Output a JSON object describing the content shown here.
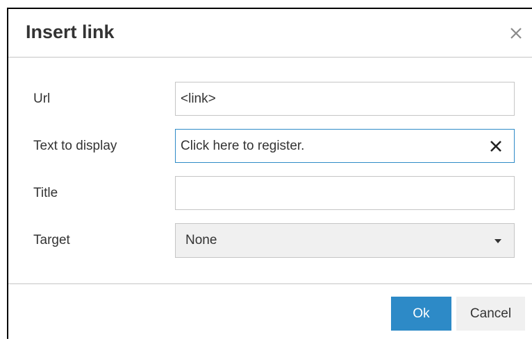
{
  "dialog": {
    "title": "Insert link",
    "close_icon": "close-icon"
  },
  "form": {
    "url": {
      "label": "Url",
      "value": "<link>"
    },
    "text_to_display": {
      "label": "Text to display",
      "value": "Click here to register.",
      "clear_icon": "clear-icon"
    },
    "title": {
      "label": "Title",
      "value": ""
    },
    "target": {
      "label": "Target",
      "selected": "None",
      "icon": "chevron-down-icon"
    }
  },
  "footer": {
    "ok_label": "Ok",
    "cancel_label": "Cancel"
  },
  "colors": {
    "primary": "#2d8ac7",
    "border": "#c5c5c5",
    "text": "#333333",
    "button_secondary": "#f0f0f0"
  }
}
